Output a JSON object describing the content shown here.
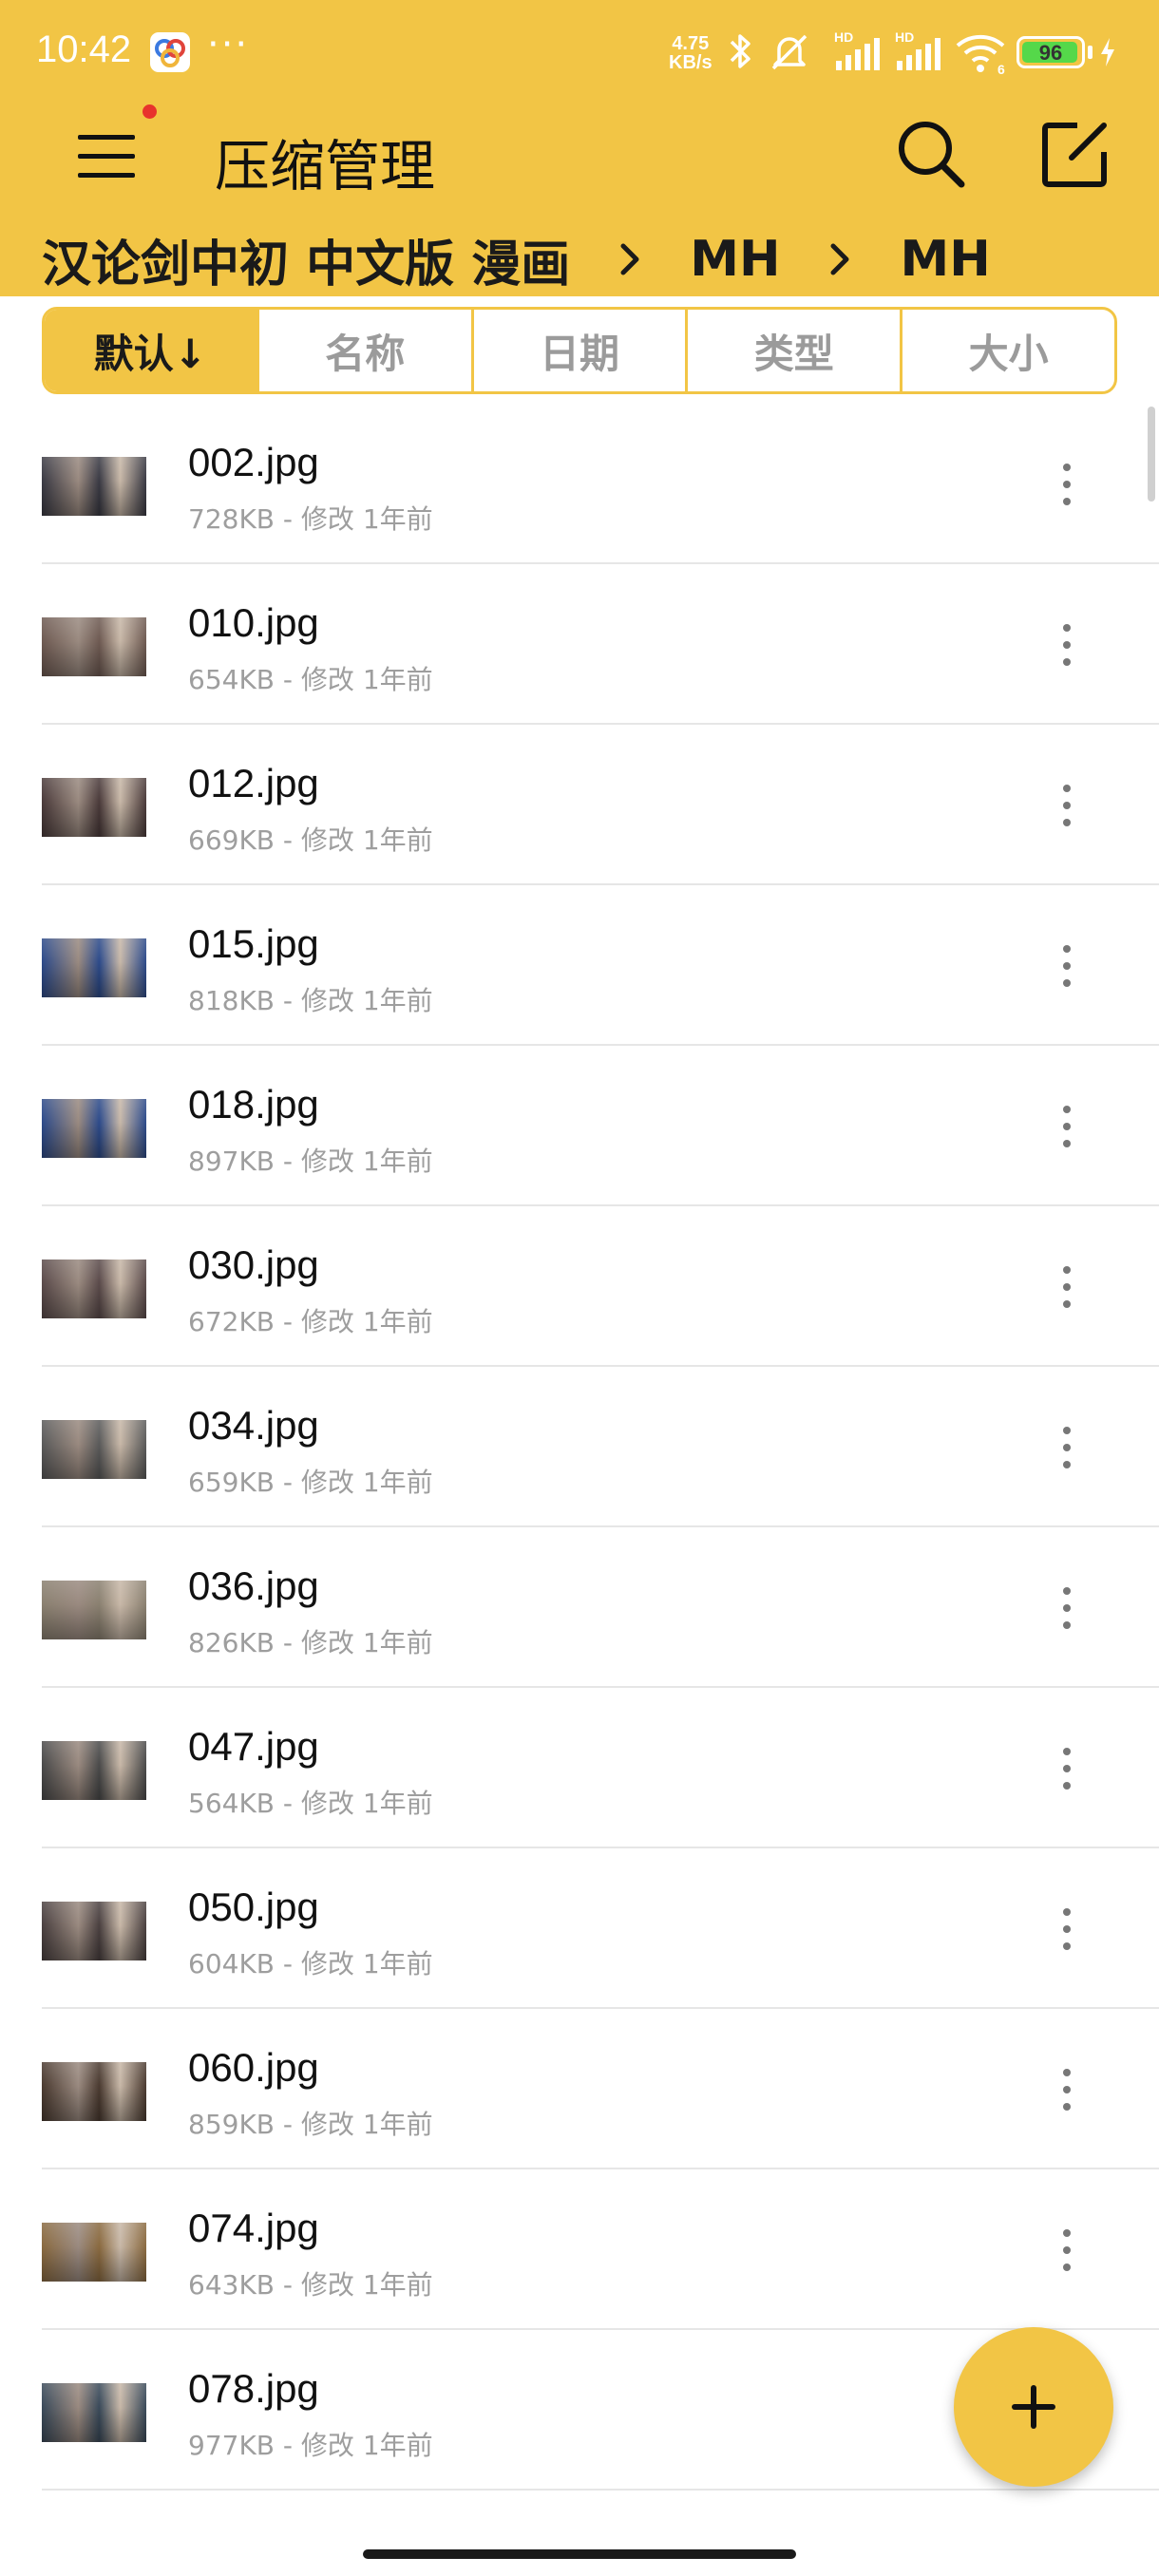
{
  "status_bar": {
    "time": "10:42",
    "dots": "···",
    "net_speed_value": "4.75",
    "net_speed_unit": "KB/s",
    "battery": "96",
    "battery_level": 0.96,
    "icons": [
      "app-notification-icon",
      "bluetooth-icon",
      "mute-icon",
      "signal-hd-icon",
      "signal-hd-icon",
      "wifi-icon",
      "battery-icon",
      "charging-icon"
    ]
  },
  "app_bar": {
    "title": "压缩管理",
    "icons": [
      "menu-icon",
      "search-icon",
      "edit-icon"
    ]
  },
  "breadcrumb": [
    "汉论剑中初 中文版 漫画",
    "MH",
    "MH"
  ],
  "sort_tabs": [
    {
      "label": "默认↓",
      "active": true
    },
    {
      "label": "名称",
      "active": false
    },
    {
      "label": "日期",
      "active": false
    },
    {
      "label": "类型",
      "active": false
    },
    {
      "label": "大小",
      "active": false
    }
  ],
  "files": [
    {
      "name": "002.jpg",
      "meta": "728KB - 修改 1年前"
    },
    {
      "name": "010.jpg",
      "meta": "654KB - 修改 1年前"
    },
    {
      "name": "012.jpg",
      "meta": "669KB - 修改 1年前"
    },
    {
      "name": "015.jpg",
      "meta": "818KB - 修改 1年前"
    },
    {
      "name": "018.jpg",
      "meta": "897KB - 修改 1年前"
    },
    {
      "name": "030.jpg",
      "meta": "672KB - 修改 1年前"
    },
    {
      "name": "034.jpg",
      "meta": "659KB - 修改 1年前"
    },
    {
      "name": "036.jpg",
      "meta": "826KB - 修改 1年前"
    },
    {
      "name": "047.jpg",
      "meta": "564KB - 修改 1年前"
    },
    {
      "name": "050.jpg",
      "meta": "604KB - 修改 1年前"
    },
    {
      "name": "060.jpg",
      "meta": "859KB - 修改 1年前"
    },
    {
      "name": "074.jpg",
      "meta": "643KB - 修改 1年前"
    },
    {
      "name": "078.jpg",
      "meta": "977KB - 修改 1年前"
    }
  ],
  "fab_icon": "plus-icon",
  "colors": {
    "accent": "#f2c545",
    "divider": "#e6e6e6",
    "meta_text": "#9e9e9e",
    "thumb_tints": [
      "#3a3a44",
      "#6e5a52",
      "#4a3a3a",
      "#2c4a8a",
      "#2c4a8a",
      "#5a4a4a",
      "#5a5a5a",
      "#8a8070",
      "#4a4a4a",
      "#4a4040",
      "#4a3a30",
      "#8a6a40",
      "#3a4a5a"
    ]
  }
}
